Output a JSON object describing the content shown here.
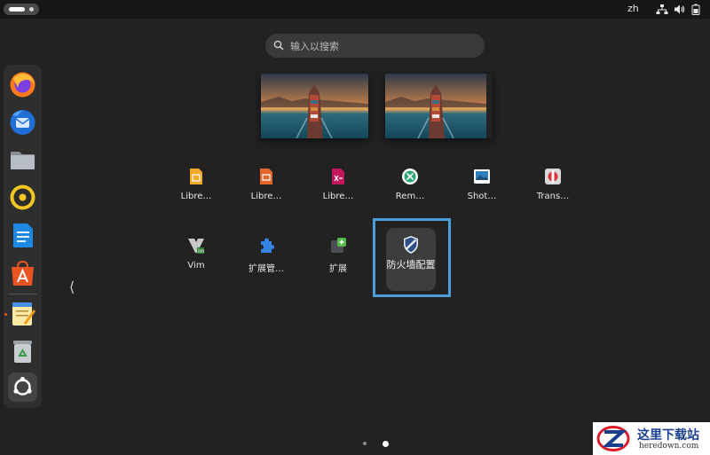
{
  "topbar": {
    "language": "zh",
    "icons": [
      "activities-indicator",
      "network-icon",
      "volume-icon",
      "battery-icon"
    ]
  },
  "search": {
    "placeholder": "输入以搜索",
    "icon": "search-icon"
  },
  "workspaces": [
    {
      "icon": "workspace-thumbnail"
    },
    {
      "icon": "workspace-thumbnail"
    }
  ],
  "dock": {
    "items": [
      {
        "name": "Firefox",
        "icon": "firefox-icon"
      },
      {
        "name": "Thunderbird",
        "icon": "thunderbird-icon"
      },
      {
        "name": "Files",
        "icon": "files-icon"
      },
      {
        "name": "Rhythmbox",
        "icon": "rhythmbox-icon"
      },
      {
        "name": "LibreOffice Writer",
        "icon": "writer-icon"
      },
      {
        "name": "App Center",
        "icon": "app-center-icon"
      },
      {
        "name": "Text Editor",
        "icon": "text-editor-icon"
      },
      {
        "name": "Trash",
        "icon": "trash-icon"
      },
      {
        "name": "Show Apps",
        "icon": "ubuntu-logo-icon"
      }
    ]
  },
  "apps": {
    "row1": [
      {
        "label": "Libre…",
        "icon": "libreoffice-base-icon"
      },
      {
        "label": "Libre…",
        "icon": "libreoffice-impress-icon"
      },
      {
        "label": "Libre…",
        "icon": "libreoffice-math-icon"
      },
      {
        "label": "Rem…",
        "icon": "remmina-icon"
      },
      {
        "label": "Shot…",
        "icon": "shotwell-icon"
      },
      {
        "label": "Trans…",
        "icon": "transmission-icon"
      }
    ],
    "row2": [
      {
        "label": "Vim",
        "icon": "vim-icon"
      },
      {
        "label": "扩展管…",
        "icon": "extension-manager-icon"
      },
      {
        "label": "扩展",
        "icon": "extensions-icon"
      }
    ],
    "selected": {
      "label": "防火墙配置",
      "icon": "firewall-shield-icon"
    }
  },
  "pager": {
    "pages": 2,
    "current": 2
  },
  "watermark": {
    "title": "这里下载站",
    "url": "heredown.com"
  },
  "colors": {
    "background": "#222222",
    "topbar": "#161616",
    "dock": "#2e2e2e",
    "focus": "#4a9fd8",
    "accent": "#e95420"
  }
}
